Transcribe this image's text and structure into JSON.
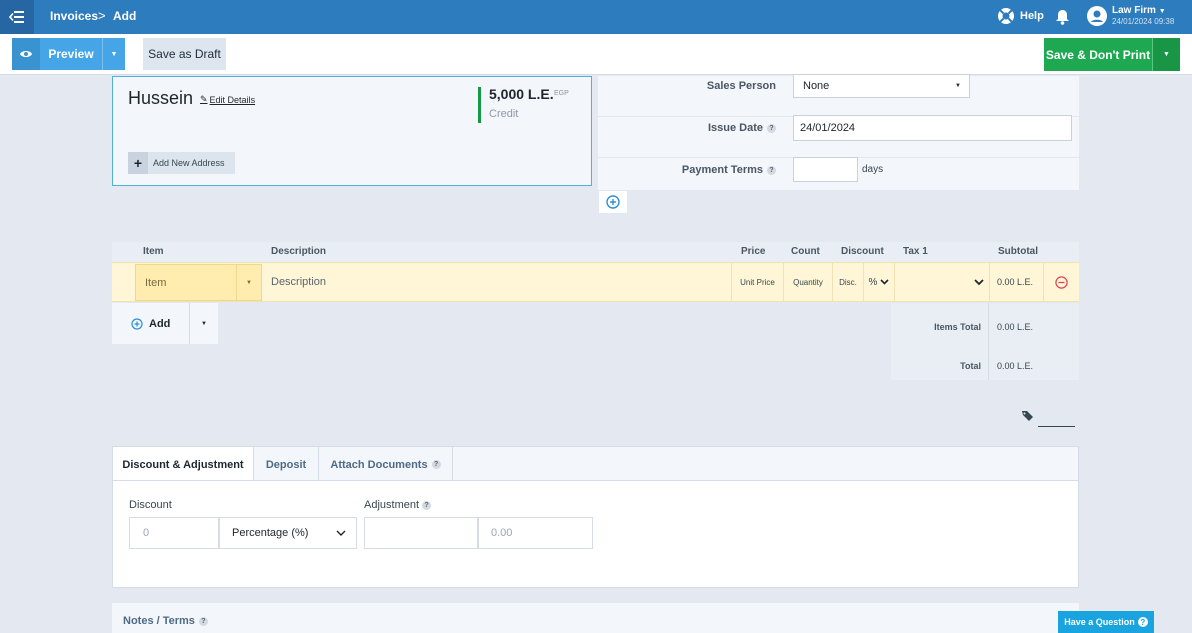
{
  "topbar": {
    "breadcrumb_parent": "Invoices",
    "breadcrumb_sep": ">",
    "breadcrumb_current": "Add",
    "help_label": "Help",
    "user_name": "Law Firm",
    "user_datetime": "24/01/2024 09:38"
  },
  "toolbar": {
    "preview_label": "Preview",
    "draft_label": "Save as Draft",
    "save_label": "Save & Don't Print"
  },
  "client": {
    "name": "Hussein",
    "edit_label": "Edit Details",
    "amount": "5,000 L.E.",
    "currency": "EGP",
    "balance_type": "Credit",
    "add_address_label": "Add New Address"
  },
  "form": {
    "sales_person_label": "Sales Person",
    "sales_person_value": "None",
    "issue_date_label": "Issue Date",
    "issue_date_value": "24/01/2024",
    "payment_terms_label": "Payment Terms",
    "payment_terms_value": "",
    "payment_terms_unit": "days",
    "help_glyph": "?"
  },
  "items": {
    "headers": {
      "item": "Item",
      "description": "Description",
      "price": "Price",
      "count": "Count",
      "discount": "Discount",
      "tax1": "Tax 1",
      "subtotal": "Subtotal"
    },
    "row": {
      "item_placeholder": "Item",
      "description_placeholder": "Description",
      "unit_price_placeholder": "Unit Price",
      "quantity_placeholder": "Quantity",
      "disc_placeholder": "Disc.",
      "disc_type": "%",
      "subtotal": "0.00 L.E."
    },
    "add_label": "Add",
    "items_total_label": "Items Total",
    "items_total_value": "0.00 L.E.",
    "total_label": "Total",
    "total_value": "0.00 L.E."
  },
  "tabs": {
    "discount_adjustment": "Discount & Adjustment",
    "deposit": "Deposit",
    "attach_documents": "Attach Documents"
  },
  "discount_panel": {
    "discount_label": "Discount",
    "discount_value_placeholder": "0",
    "discount_type": "Percentage (%)",
    "adjustment_label": "Adjustment",
    "adjustment_name": "",
    "adjustment_value_placeholder": "0.00"
  },
  "notes": {
    "label": "Notes / Terms",
    "question_button": "Have a Question"
  },
  "colors": {
    "topbar": "#2d7cbd",
    "primary": "#45a5e6",
    "save": "#1da851",
    "item_row": "#fff6d8",
    "question": "#19a4e0"
  }
}
